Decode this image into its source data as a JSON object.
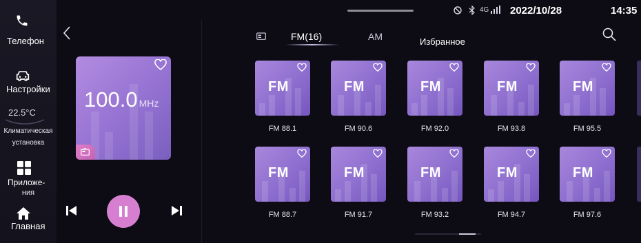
{
  "nav": {
    "phone_label": "Телефон",
    "settings_label": "Настройки",
    "temperature": "22.5°C",
    "climate_label_line1": "Климатическая",
    "climate_label_line2": "установка",
    "apps_label_line1": "Приложе-",
    "apps_label_line2": "ния",
    "home_label": "Главная"
  },
  "status": {
    "date": "2022/10/28",
    "time": "14:35",
    "network": "4G"
  },
  "now_playing": {
    "frequency": "100.0",
    "unit": "MHz",
    "favorite": false
  },
  "tabs": {
    "radio_icon": "radio-icon",
    "fm_label": "FM(16)",
    "am_label": "AM",
    "favorites_label": "Избранное",
    "active": "fm"
  },
  "stations": [
    {
      "art": "FM",
      "label": "FM 88.1"
    },
    {
      "art": "FM",
      "label": "FM 90.6"
    },
    {
      "art": "FM",
      "label": "FM 92.0"
    },
    {
      "art": "FM",
      "label": "FM 93.8"
    },
    {
      "art": "FM",
      "label": "FM 95.5"
    },
    {
      "art": "FM",
      "label": "FM 88.7"
    },
    {
      "art": "FM",
      "label": "FM 91.7"
    },
    {
      "art": "FM",
      "label": "FM 93.2"
    },
    {
      "art": "FM",
      "label": "FM 94.7"
    },
    {
      "art": "FM",
      "label": "FM 97.6"
    }
  ],
  "colors": {
    "accent": "#d67fd1",
    "card": "#9a7bd6",
    "background": "#0d0c14"
  }
}
